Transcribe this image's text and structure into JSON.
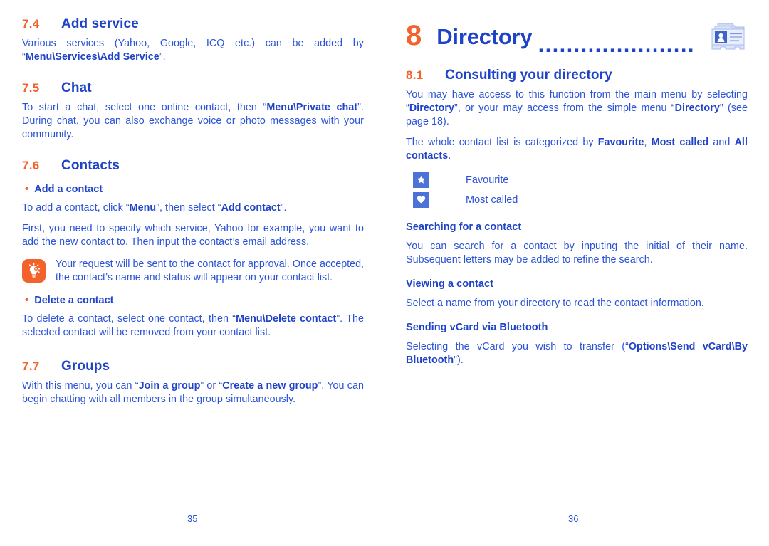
{
  "colors": {
    "orange": "#F4622B",
    "blue": "#2B53D8",
    "blue_bold": "#1F43C8",
    "icon_blue": "#4B73D6"
  },
  "left_page": {
    "page_number": "35",
    "sections": {
      "add_service": {
        "number": "7.4",
        "title": "Add service",
        "para_1_a": "Various services (Yahoo, Google, ICQ etc.) can be added by “",
        "para_1_b": "Menu\\Services\\Add Service",
        "para_1_c": "”."
      },
      "chat": {
        "number": "7.5",
        "title": "Chat",
        "para_1_a": "To start a chat, select one online contact, then “",
        "para_1_b": "Menu\\Private chat",
        "para_1_c": "”. During chat, you can also exchange voice or photo messages with your community."
      },
      "contacts": {
        "number": "7.6",
        "title": "Contacts",
        "add_contact": {
          "bullet": "•",
          "heading": "Add a contact",
          "para_1_a": "To add a contact, click “",
          "para_1_b": "Menu",
          "para_1_c": "”, then select “",
          "para_1_d": "Add contact",
          "para_1_e": "”.",
          "para_2": "First, you need to specify which service, Yahoo for example, you want to add the new contact to. Then input the contact’s email address.",
          "tip_text": "Your request will be sent to the contact for approval. Once accepted, the contact’s name and status will appear on your contact list."
        },
        "delete_contact": {
          "bullet": "•",
          "heading": "Delete a contact",
          "para_1_a": "To delete a contact, select one contact, then “",
          "para_1_b": "Menu\\Delete contact",
          "para_1_c": "”. The selected contact will be removed from your contact list."
        }
      },
      "groups": {
        "number": "7.7",
        "title": "Groups",
        "para_1_a": "With this menu, you can “",
        "para_1_b": "Join a group",
        "para_1_c": "” or “",
        "para_1_d": "Create a new group",
        "para_1_e": "”. You can begin chatting with all members in the group simultaneously."
      }
    }
  },
  "right_page": {
    "page_number": "36",
    "chapter": {
      "number": "8",
      "title": "Directory",
      "dots": "......................",
      "icon": "contact-card-icon"
    },
    "sections": {
      "consulting": {
        "number": "8.1",
        "title": "Consulting your directory",
        "para_1_a": "You may have access to this function from the main menu by selecting “",
        "para_1_b": "Directory",
        "para_1_c": "”, or your may access from the simple menu “",
        "para_1_d": "Directory",
        "para_1_e": "” (see page 18).",
        "para_2_a": "The whole contact list is categorized by ",
        "para_2_b": "Favourite",
        "para_2_c": ", ",
        "para_2_d": "Most called",
        "para_2_e": " and ",
        "para_2_f": "All contacts",
        "para_2_g": ".",
        "legend": [
          {
            "icon": "star-icon",
            "label": "Favourite"
          },
          {
            "icon": "heart-icon",
            "label": "Most called"
          }
        ]
      },
      "searching": {
        "heading": "Searching for a contact",
        "para_1": "You can search for a contact by inputing the initial of their name. Subsequent letters may be added to refine the search."
      },
      "viewing": {
        "heading": "Viewing a contact",
        "para_1": "Select a name from your directory to read the contact information."
      },
      "vcard": {
        "heading": "Sending vCard via Bluetooth",
        "para_1_a": "Selecting the vCard you wish to transfer (“",
        "para_1_b": "Options\\Send vCard\\By Bluetooth",
        "para_1_c": "”)."
      }
    }
  }
}
